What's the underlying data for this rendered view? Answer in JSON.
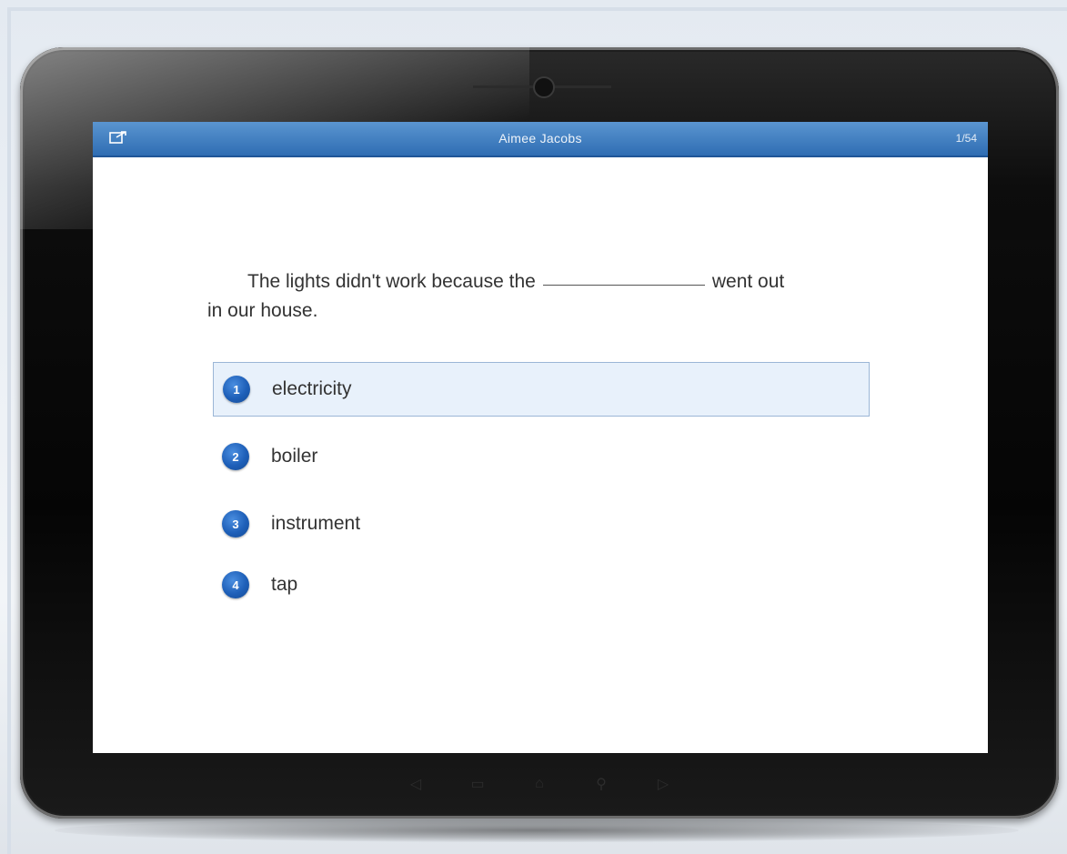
{
  "app": {
    "header_title": "Aimee Jacobs",
    "counter": "1/54"
  },
  "question": {
    "text_before": "The lights didn't work because the",
    "text_after_line1": "went out",
    "text_after_line2": "in our house."
  },
  "options": [
    {
      "number": "1",
      "label": "electricity",
      "selected": true
    },
    {
      "number": "2",
      "label": "boiler",
      "selected": false
    },
    {
      "number": "3",
      "label": "instrument",
      "selected": false
    },
    {
      "number": "4",
      "label": "tap",
      "selected": false
    }
  ],
  "nav_icons": [
    "back-icon",
    "recent-apps-icon",
    "home-icon",
    "search-icon",
    "forward-icon"
  ],
  "colors": {
    "header_blue": "#2f6db3",
    "option_blue": "#1e5fb8",
    "selected_bg": "#e8f1fb",
    "selected_border": "#9bb6d6"
  }
}
